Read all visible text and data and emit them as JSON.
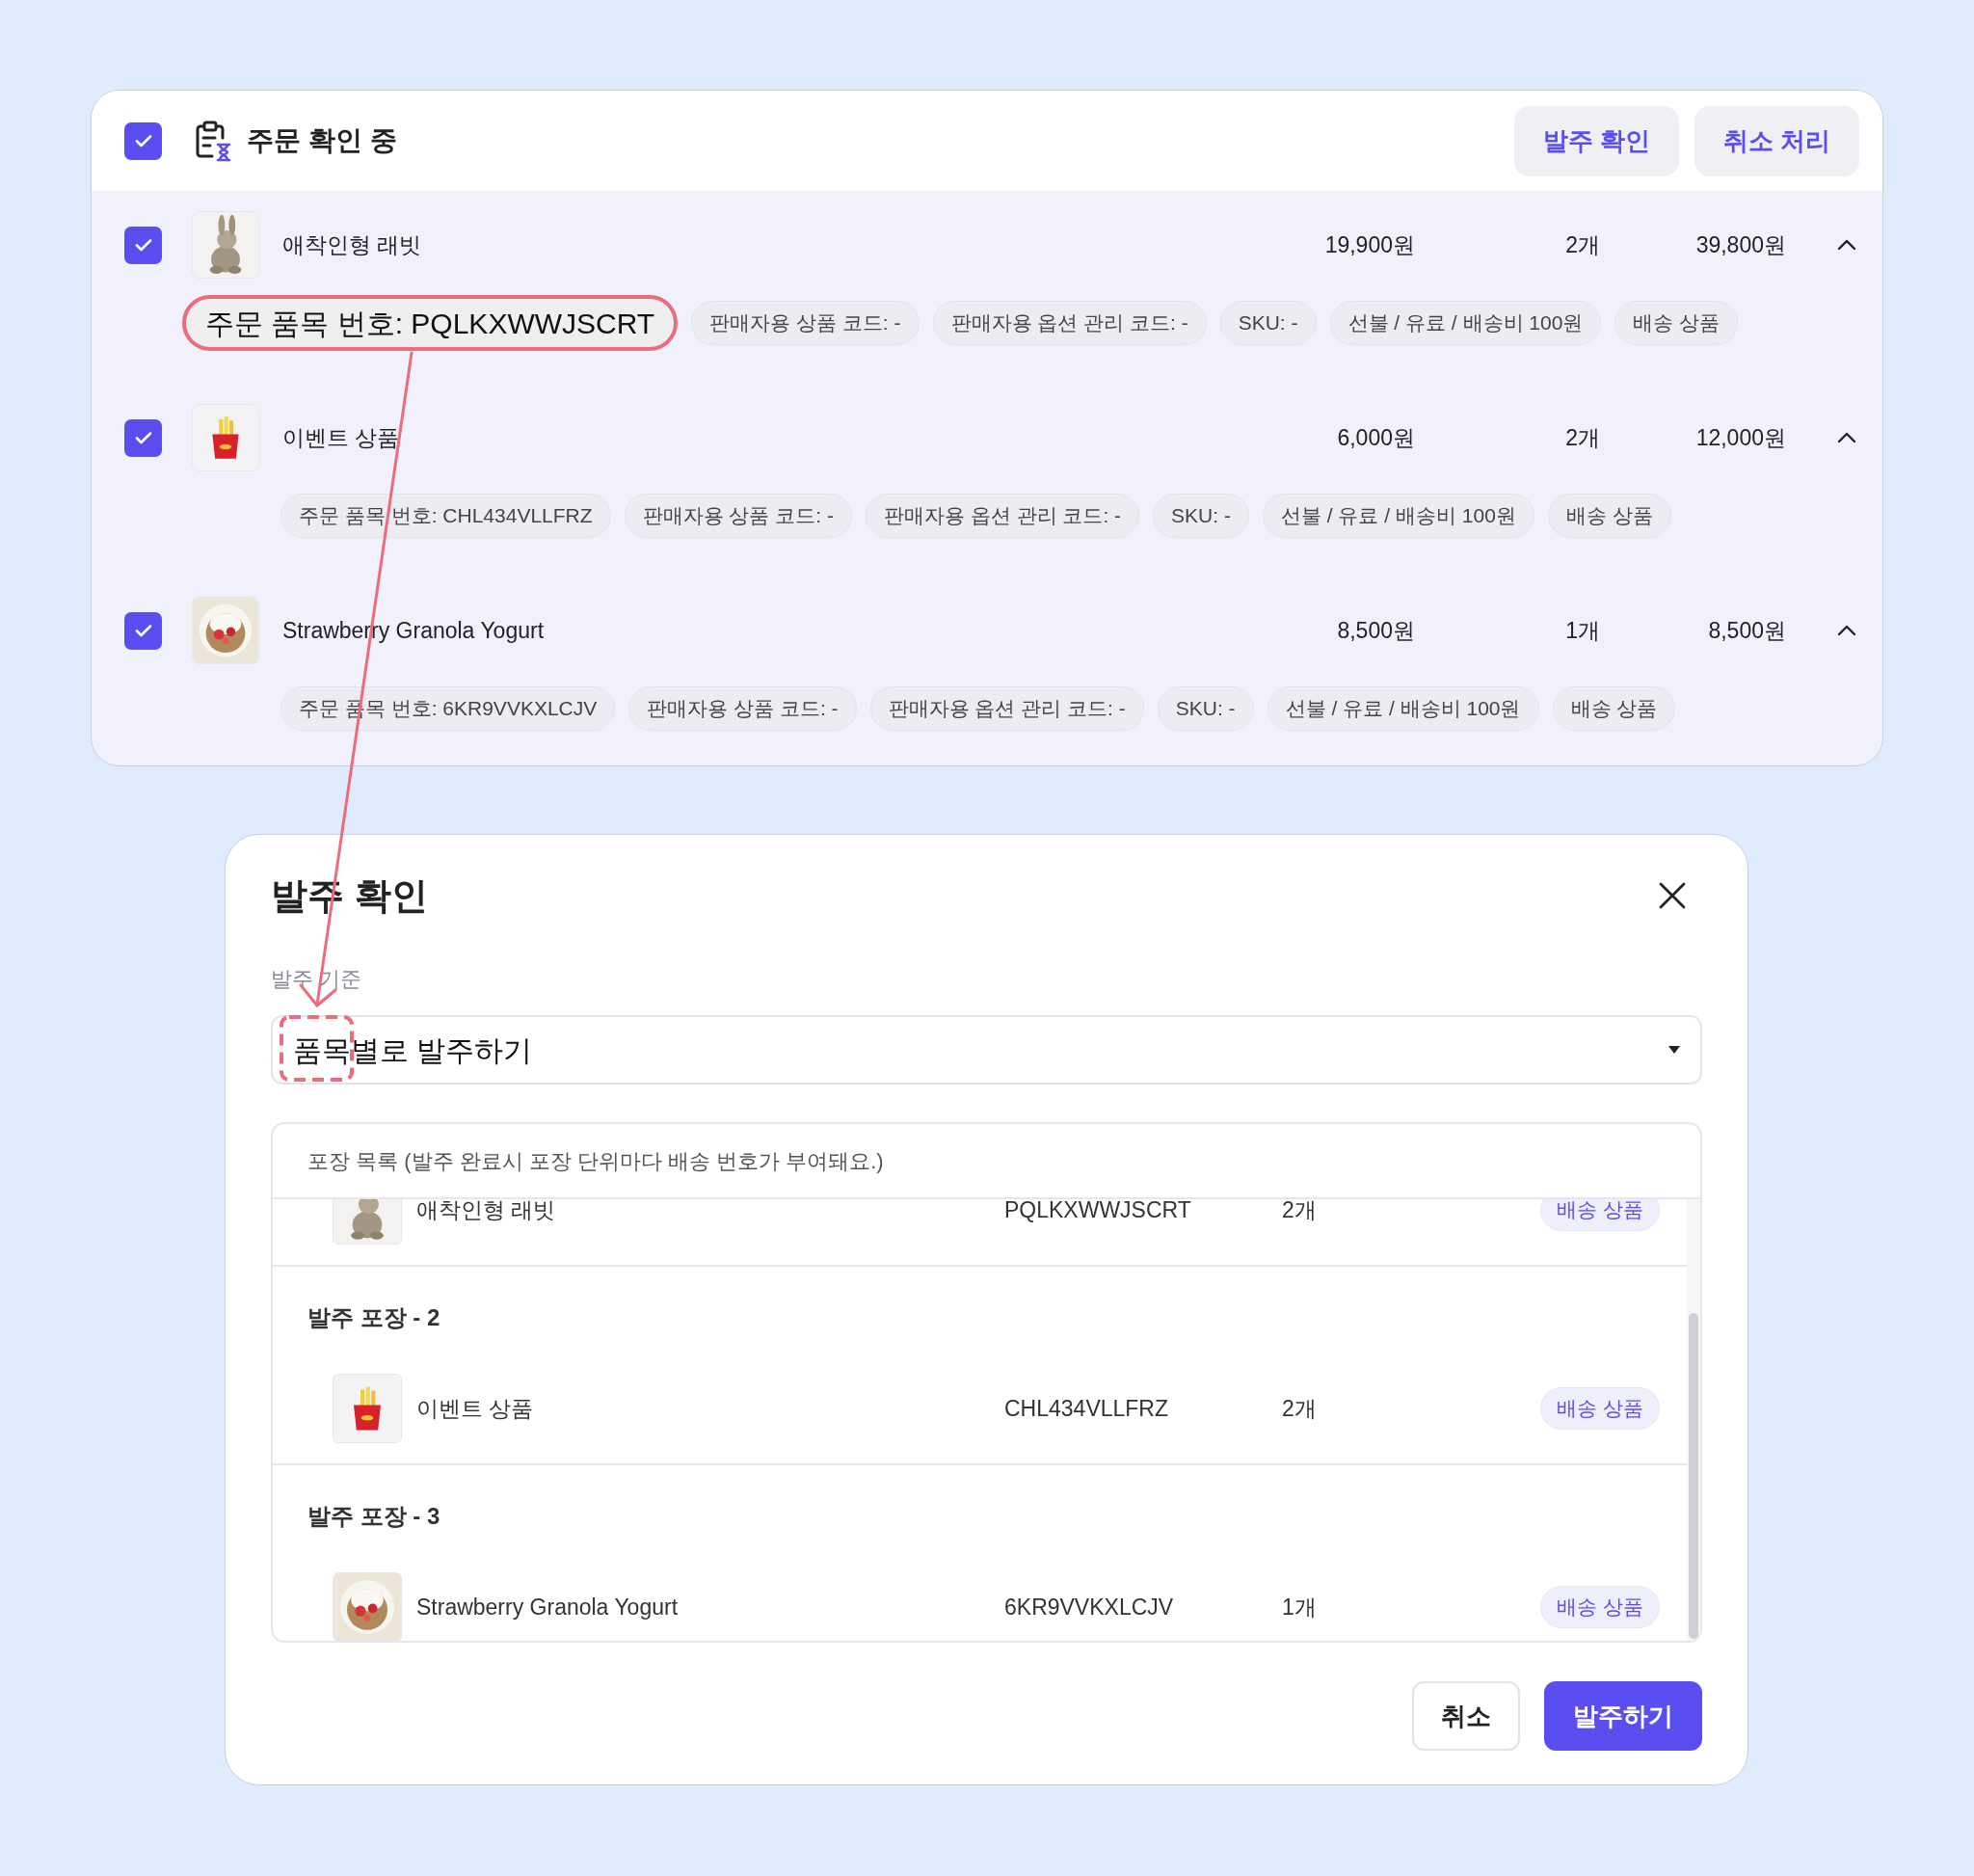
{
  "order_group": {
    "title": "주문 확인 중",
    "checked": true,
    "buttons": [
      "발주 확인",
      "취소 처리"
    ],
    "items": [
      {
        "name": "애착인형 래빗",
        "checked": true,
        "expanded": true,
        "unit_price": "19,900원",
        "quantity": "2개",
        "total": "39,800원",
        "chips": [
          {
            "text": "주문 품목 번호: PQLKXWWJSCRT",
            "highlighted": true
          },
          {
            "text": "판매자용 상품 코드: -",
            "highlighted": false
          },
          {
            "text": "판매자용 옵션 관리 코드: -",
            "highlighted": false
          },
          {
            "text": "SKU: -",
            "highlighted": false
          },
          {
            "text": "선불 / 유료 / 배송비 100원",
            "highlighted": false
          },
          {
            "text": "배송 상품",
            "highlighted": false
          }
        ]
      },
      {
        "name": "이벤트 상품",
        "checked": true,
        "expanded": true,
        "unit_price": "6,000원",
        "quantity": "2개",
        "total": "12,000원",
        "chips": [
          {
            "text": "주문 품목 번호: CHL434VLLFRZ",
            "highlighted": false
          },
          {
            "text": "판매자용 상품 코드: -",
            "highlighted": false
          },
          {
            "text": "판매자용 옵션 관리 코드: -",
            "highlighted": false
          },
          {
            "text": "SKU: -",
            "highlighted": false
          },
          {
            "text": "선불 / 유료 / 배송비 100원",
            "highlighted": false
          },
          {
            "text": "배송 상품",
            "highlighted": false
          }
        ]
      },
      {
        "name": "Strawberry Granola Yogurt",
        "checked": true,
        "expanded": true,
        "unit_price": "8,500원",
        "quantity": "1개",
        "total": "8,500원",
        "chips": [
          {
            "text": "주문 품목 번호: 6KR9VVKXLCJV",
            "highlighted": false
          },
          {
            "text": "판매자용 상품 코드: -",
            "highlighted": false
          },
          {
            "text": "판매자용 옵션 관리 코드: -",
            "highlighted": false
          },
          {
            "text": "SKU: -",
            "highlighted": false
          },
          {
            "text": "선불 / 유료 / 배송비 100원",
            "highlighted": false
          },
          {
            "text": "배송 상품",
            "highlighted": false
          }
        ]
      }
    ]
  },
  "dialog": {
    "title": "발주 확인",
    "field_label": "발주 기준",
    "select_value": "품목별로 발주하기",
    "list_header": "포장 목록 (발주 완료시 포장 단위마다 배송 번호가 부여돼요.)",
    "packages": [
      {
        "items": [
          {
            "name": "애착인형 래빗",
            "code": "PQLKXWWJSCRT",
            "quantity": "2개",
            "badge": "배송 상품"
          }
        ]
      },
      {
        "label": "발주 포장 - 2",
        "items": [
          {
            "name": "이벤트 상품",
            "code": "CHL434VLLFRZ",
            "quantity": "2개",
            "badge": "배송 상품"
          }
        ]
      },
      {
        "label": "발주 포장 - 3",
        "items": [
          {
            "name": "Strawberry Granola Yogurt",
            "code": "6KR9VVKXLCJV",
            "quantity": "1개",
            "badge": "배송 상품"
          }
        ]
      }
    ],
    "buttons": [
      {
        "label": "취소",
        "kind": "secondary"
      },
      {
        "label": "발주하기",
        "kind": "primary"
      }
    ]
  }
}
